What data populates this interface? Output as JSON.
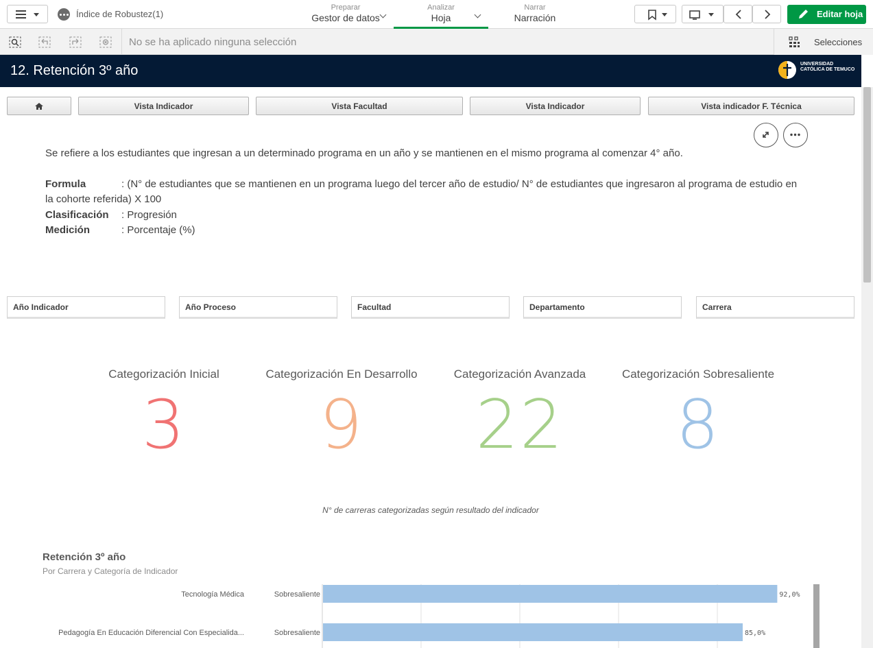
{
  "topbar": {
    "app_title": "Índice de Robustez(1)",
    "tabs": [
      {
        "small": "Preparar",
        "big": "Gestor de datos"
      },
      {
        "small": "Analizar",
        "big": "Hoja"
      },
      {
        "small": "Narrar",
        "big": "Narración"
      }
    ],
    "edit_label": "Editar hoja"
  },
  "selections": {
    "no_selection": "No se ha aplicado ninguna selección",
    "panel_label": "Selecciones"
  },
  "sheet": {
    "title": "12. Retención 3º año",
    "logo_text": "UNIVERSIDAD CATÓLICA DE TEMUCO"
  },
  "nav_buttons": [
    "Vista Indicador",
    "Vista Facultad",
    "Vista Indicador",
    "Vista indicador F. Técnica"
  ],
  "description": {
    "text": "Se refiere a los estudiantes que ingresan a un determinado programa en un año y se mantienen en el mismo programa al comenzar 4° año.",
    "formula_label": "Formula",
    "formula_line1": ": (N° de estudiantes que se mantienen en un programa luego del tercer año de estudio/ N° de estudiantes que ingresaron al programa de estudio en",
    "formula_line2": "la cohorte referida) X 100",
    "clasificacion_label": "Clasificación",
    "clasificacion_value": ": Progresión",
    "medicion_label": "Medición",
    "medicion_value": ": Porcentaje (%)"
  },
  "filters": [
    "Año Indicador",
    "Año Proceso",
    "Facultad",
    "Departamento",
    "Carrera"
  ],
  "kpis": [
    {
      "label": "Categorización Inicial",
      "value": "3",
      "color": "#f07373"
    },
    {
      "label": "Categorización En Desarrollo",
      "value": "9",
      "color": "#f4b28b"
    },
    {
      "label": "Categorización Avanzada",
      "value": "22",
      "color": "#a6d08a"
    },
    {
      "label": "Categorización Sobresaliente",
      "value": "8",
      "color": "#9fc3e6"
    }
  ],
  "kpi_caption": "N° de carreras categorizadas según resultado del indicador",
  "chart": {
    "title": "Retención 3º año",
    "subtitle": "Por Carrera y Categoría de Indicador"
  },
  "chart_data": {
    "type": "bar",
    "orientation": "horizontal",
    "title": "Retención 3º año",
    "subtitle": "Por Carrera y Categoría de Indicador",
    "categories": [
      "Tecnología Médica",
      "Pedagogía En Educación Diferencial Con Especialida..."
    ],
    "groups": [
      "Sobresaliente",
      "Sobresaliente"
    ],
    "values": [
      92.0,
      85.0
    ],
    "value_labels": [
      "92,0%",
      "85,0%"
    ],
    "xlim": [
      0,
      100
    ],
    "bar_color": "#9fc3e6",
    "grid": true
  }
}
